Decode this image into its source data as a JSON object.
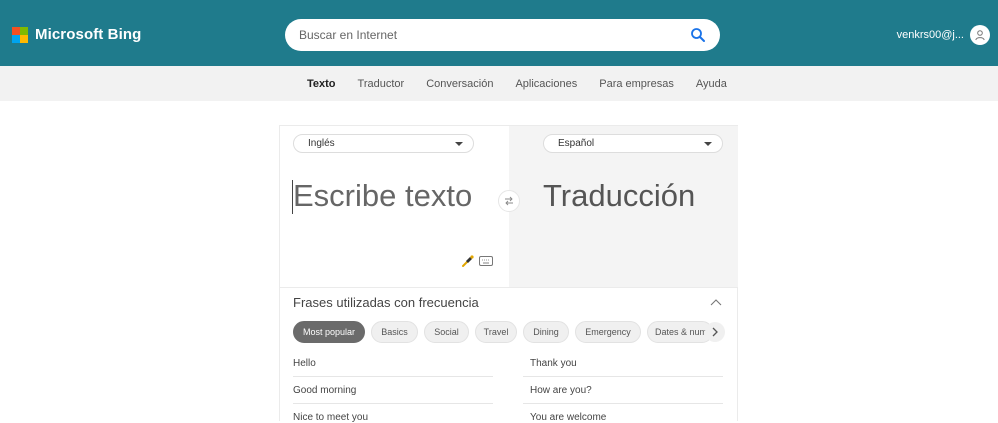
{
  "header": {
    "brand": "Microsoft Bing",
    "search_placeholder": "Buscar en Internet",
    "user": "venkrs00@j..."
  },
  "nav": {
    "items": [
      "Texto",
      "Traductor",
      "Conversación",
      "Aplicaciones",
      "Para empresas",
      "Ayuda"
    ],
    "active": "Texto"
  },
  "translator": {
    "source_lang": "Inglés",
    "target_lang": "Español",
    "source_placeholder": "Escribe texto",
    "target_placeholder": "Traducción"
  },
  "phrases": {
    "title": "Frases utilizadas con frecuencia",
    "categories": [
      "Most popular",
      "Basics",
      "Social",
      "Travel",
      "Dining",
      "Emergency",
      "Dates & numbers"
    ],
    "active_category": "Most popular",
    "left": [
      "Hello",
      "Good morning",
      "Nice to meet you"
    ],
    "right": [
      "Thank you",
      "How are you?",
      "You are welcome"
    ]
  },
  "colors": {
    "header_bg": "#1f7b8c",
    "nav_bg": "#f2f2f2",
    "accent": "#1a73e8"
  }
}
